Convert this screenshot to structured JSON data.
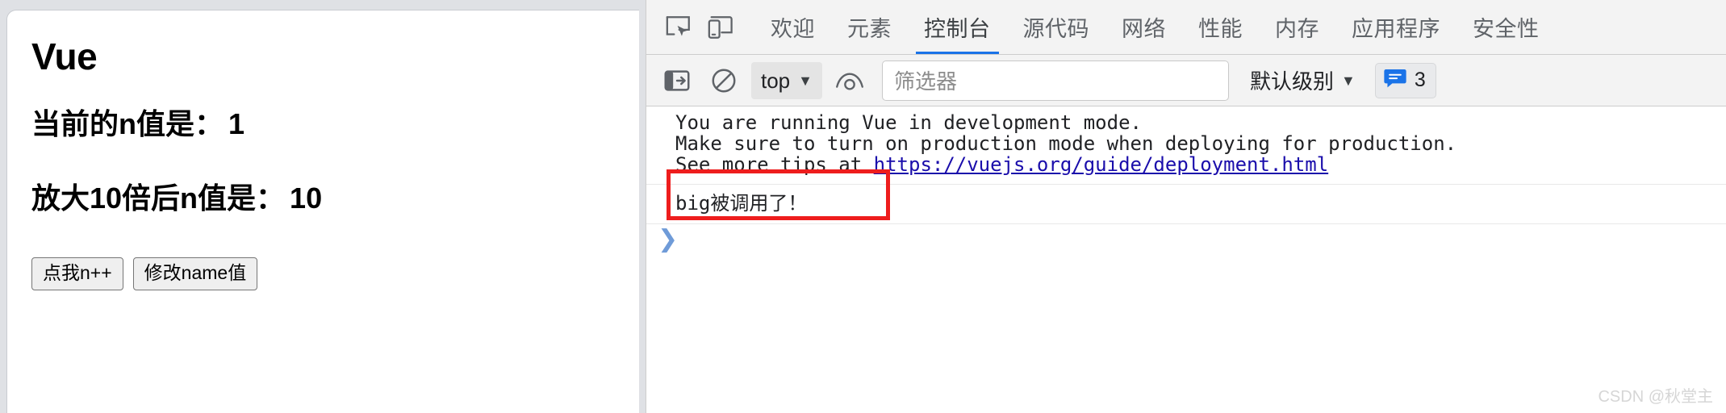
{
  "page": {
    "title": "Vue",
    "lines": [
      {
        "label": "当前的n值是：",
        "value": "1"
      },
      {
        "label": "放大10倍后n值是：",
        "value": "10"
      }
    ],
    "buttons": [
      {
        "label": "点我n++",
        "name": "increment-button"
      },
      {
        "label": "修改name值",
        "name": "change-name-button"
      }
    ]
  },
  "devtools": {
    "icons": {
      "inspect": "inspect-element-icon",
      "device": "device-toolbar-icon",
      "sidebar": "console-sidebar-icon",
      "clear": "clear-console-icon",
      "eye": "live-expression-icon",
      "message": "message-bubble-icon"
    },
    "tabs": [
      {
        "label": "欢迎",
        "active": false
      },
      {
        "label": "元素",
        "active": false
      },
      {
        "label": "控制台",
        "active": true
      },
      {
        "label": "源代码",
        "active": false
      },
      {
        "label": "网络",
        "active": false
      },
      {
        "label": "性能",
        "active": false
      },
      {
        "label": "内存",
        "active": false
      },
      {
        "label": "应用程序",
        "active": false
      },
      {
        "label": "安全性",
        "active": false
      }
    ],
    "toolbar": {
      "context_value": "top",
      "filter_placeholder": "筛选器",
      "filter_value": "",
      "level_label": "默认级别",
      "message_count": "3",
      "caret_glyph": "▼"
    },
    "console": {
      "warning_lines": [
        "You are running Vue in development mode.",
        "Make sure to turn on production mode when deploying for production.",
        "See more tips at "
      ],
      "warning_link": "https://vuejs.org/guide/deployment.html",
      "log_message": "big被调用了！",
      "prompt_glyph": "❯"
    }
  },
  "watermark": "CSDN @秋堂主",
  "colors": {
    "accent": "#1a73e8",
    "link": "#1a0dab",
    "annotation": "#ee1d1d",
    "toolbar_bg": "#f3f3f3",
    "page_bg": "#dfe1e5"
  }
}
